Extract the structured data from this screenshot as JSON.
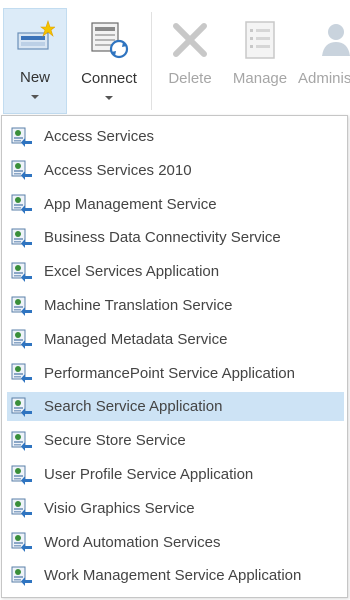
{
  "ribbon": {
    "new_label": "New",
    "connect_label": "Connect",
    "delete_label": "Delete",
    "manage_label": "Manage",
    "admin_label": "Adminis"
  },
  "menu": {
    "selected_index": 8,
    "items": [
      {
        "label": "Access Services"
      },
      {
        "label": "Access Services 2010"
      },
      {
        "label": "App Management Service"
      },
      {
        "label": "Business Data Connectivity Service"
      },
      {
        "label": "Excel Services Application"
      },
      {
        "label": "Machine Translation Service"
      },
      {
        "label": "Managed Metadata Service"
      },
      {
        "label": "PerformancePoint Service Application"
      },
      {
        "label": "Search Service Application"
      },
      {
        "label": "Secure Store Service"
      },
      {
        "label": "User Profile Service Application"
      },
      {
        "label": "Visio Graphics Service"
      },
      {
        "label": "Word Automation Services"
      },
      {
        "label": "Work Management Service Application"
      }
    ]
  },
  "colors": {
    "selected_bg": "#cde3f5",
    "new_button_bg": "#dcebf8",
    "disabled_text": "#a6a6a6",
    "icon_blue": "#2f74c0",
    "icon_green": "#3a8f3a"
  },
  "icons": {
    "new": "new-service-icon",
    "connect": "connect-icon",
    "delete": "delete-icon",
    "manage": "manage-icon",
    "admin": "administrators-icon",
    "menu_item": "service-application-icon"
  }
}
